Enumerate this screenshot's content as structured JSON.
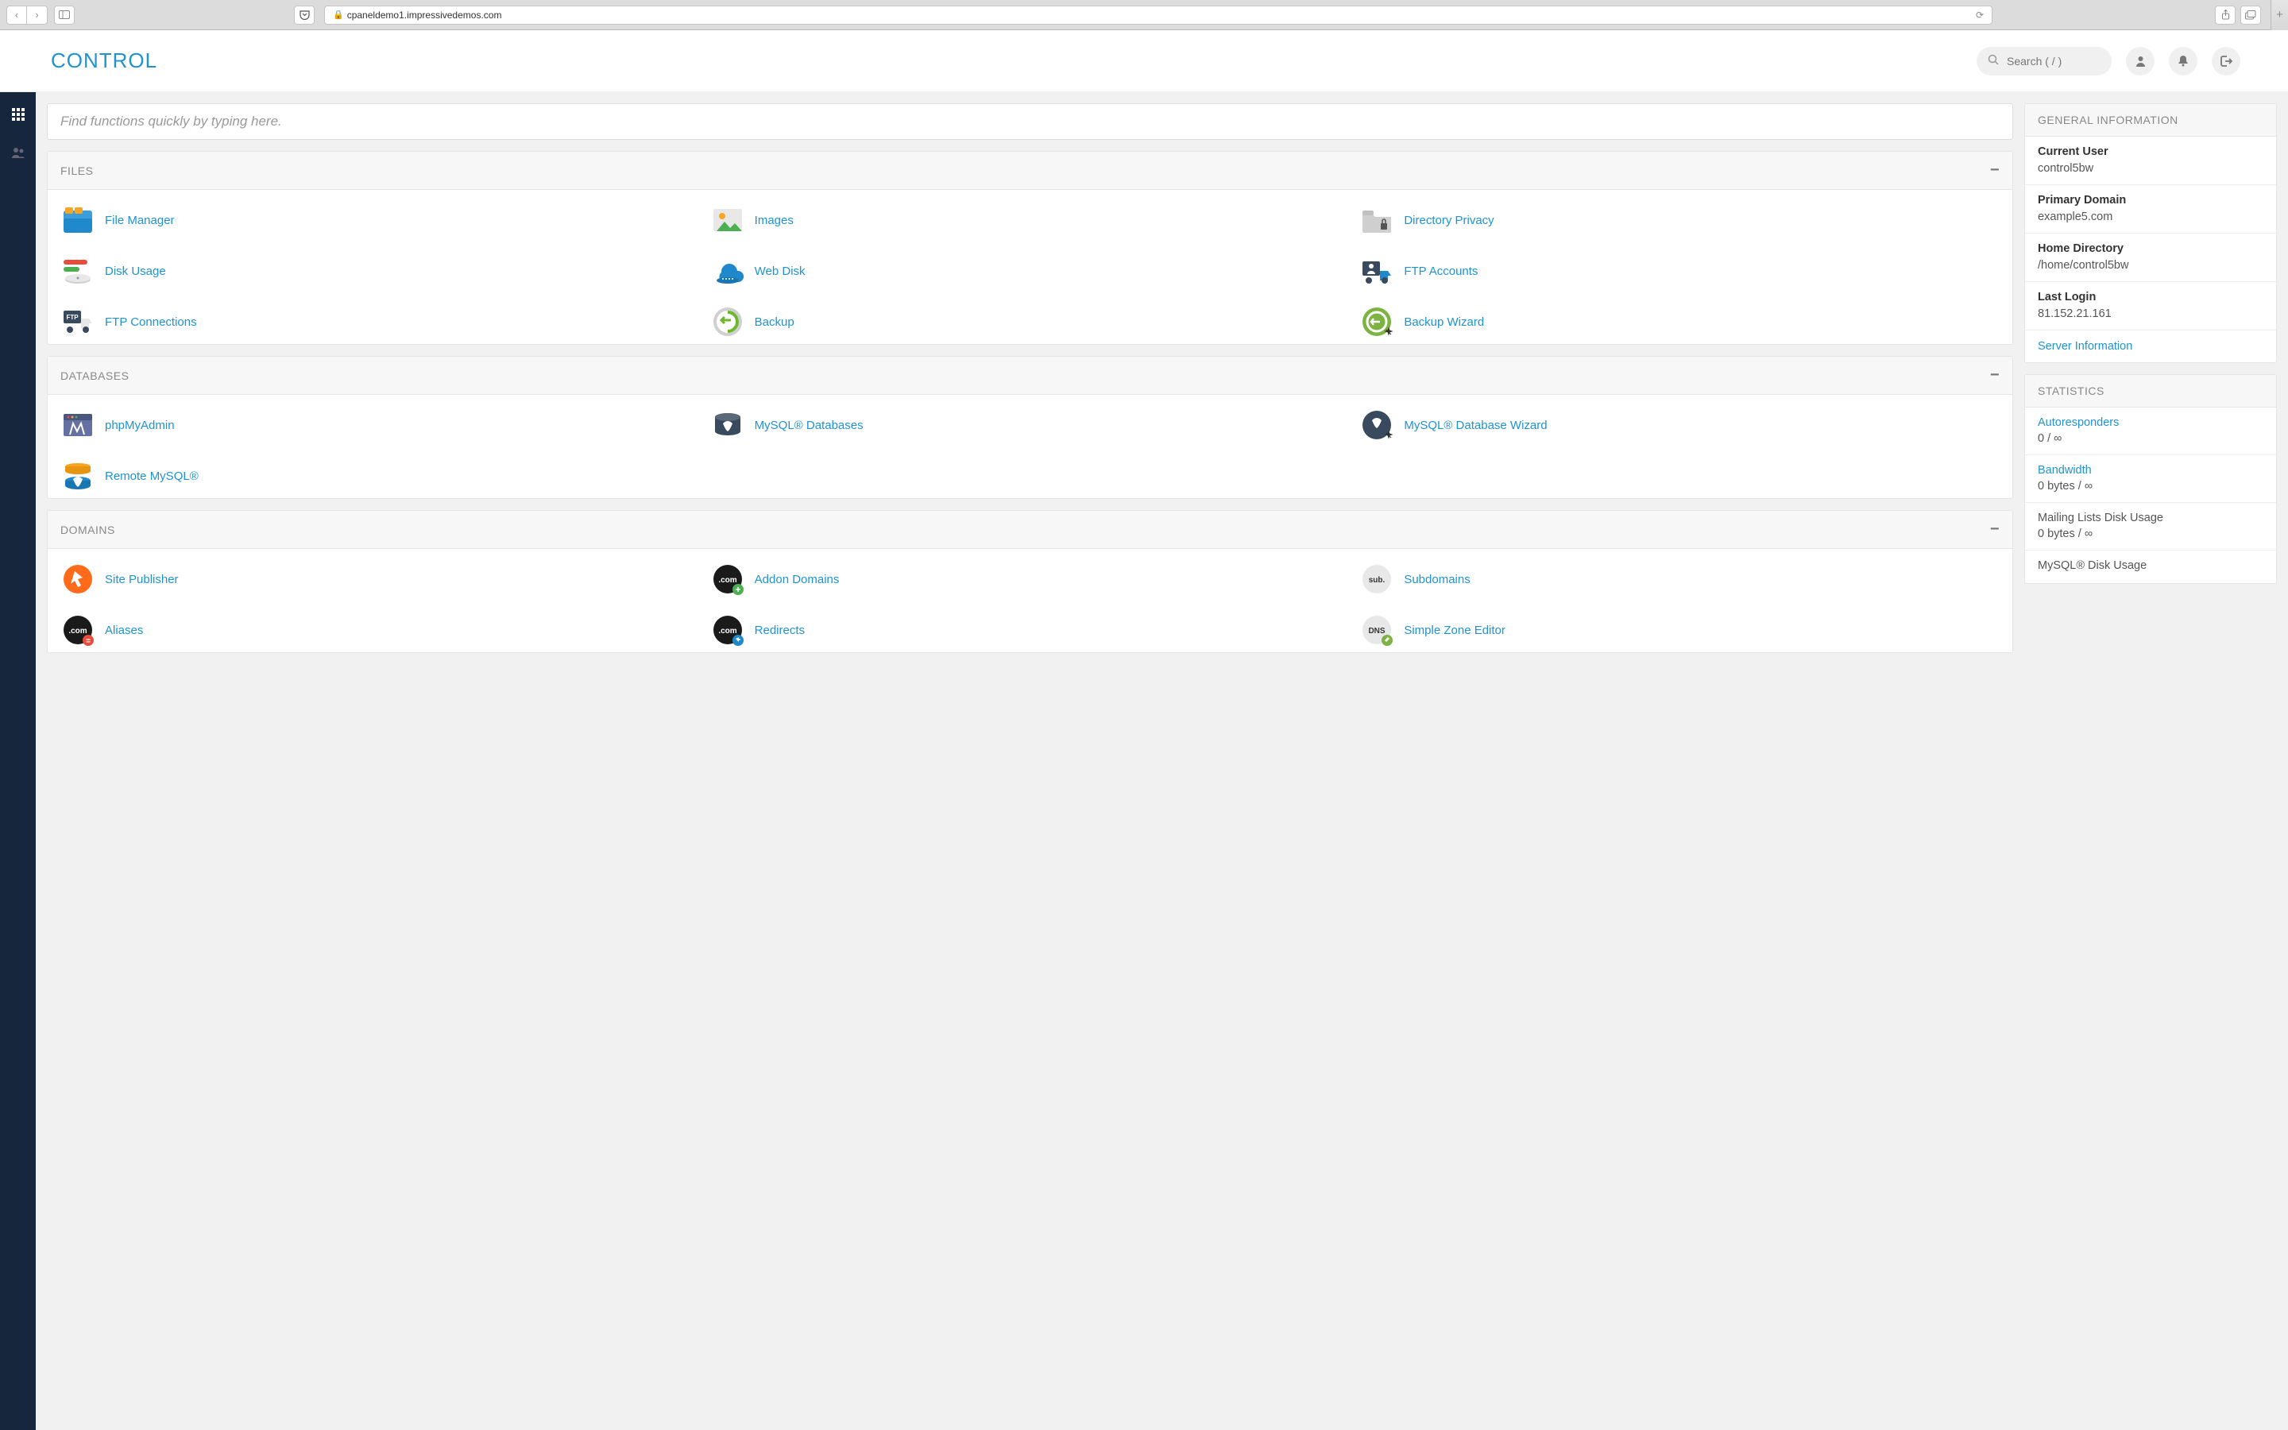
{
  "browser": {
    "url": "cpaneldemo1.impressivedemos.com"
  },
  "header": {
    "brand": "CONTROL",
    "search_placeholder": "Search ( / )"
  },
  "quick_search": {
    "placeholder": "Find functions quickly by typing here."
  },
  "sections": {
    "files": {
      "title": "FILES",
      "items": [
        {
          "label": "File Manager"
        },
        {
          "label": "Images"
        },
        {
          "label": "Directory Privacy"
        },
        {
          "label": "Disk Usage"
        },
        {
          "label": "Web Disk"
        },
        {
          "label": "FTP Accounts"
        },
        {
          "label": "FTP Connections"
        },
        {
          "label": "Backup"
        },
        {
          "label": "Backup Wizard"
        }
      ]
    },
    "databases": {
      "title": "DATABASES",
      "items": [
        {
          "label": "phpMyAdmin"
        },
        {
          "label": "MySQL® Databases"
        },
        {
          "label": "MySQL® Database Wizard"
        },
        {
          "label": "Remote MySQL®"
        }
      ]
    },
    "domains": {
      "title": "DOMAINS",
      "items": [
        {
          "label": "Site Publisher"
        },
        {
          "label": "Addon Domains"
        },
        {
          "label": "Subdomains"
        },
        {
          "label": "Aliases"
        },
        {
          "label": "Redirects"
        },
        {
          "label": "Simple Zone Editor"
        }
      ]
    }
  },
  "general_info": {
    "title": "GENERAL INFORMATION",
    "rows": [
      {
        "label": "Current User",
        "value": "control5bw"
      },
      {
        "label": "Primary Domain",
        "value": "example5.com"
      },
      {
        "label": "Home Directory",
        "value": "/home/control5bw"
      },
      {
        "label": "Last Login",
        "value": "81.152.21.161"
      }
    ],
    "link": "Server Information"
  },
  "statistics": {
    "title": "STATISTICS",
    "rows": [
      {
        "label": "Autoresponders",
        "value": "0 / ∞",
        "link": true
      },
      {
        "label": "Bandwidth",
        "value": "0 bytes / ∞",
        "link": true
      },
      {
        "label": "Mailing Lists Disk Usage",
        "value": "0 bytes / ∞",
        "link": false
      },
      {
        "label": "MySQL® Disk Usage",
        "value": "",
        "link": false
      }
    ]
  }
}
